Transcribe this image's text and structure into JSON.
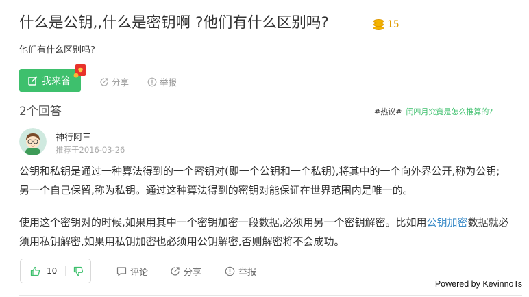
{
  "question": {
    "title": "什么是公钥,,什么是密钥啊 ?他们有什么区别吗?",
    "coin_count": "15",
    "coin_icon": "coin-stack-icon",
    "description": "他们有什么区别吗?",
    "answer_button_label": "我来答",
    "share_label": "分享",
    "report_label": "举报"
  },
  "answers_header": {
    "count_label": "2个回答",
    "hot_tag": "#热议#",
    "hot_link": "闰四月究竟是怎么推算的?"
  },
  "answer": {
    "user_name": "神行阿三",
    "recommend_time": "推荐于2016-03-26",
    "paragraph1": "公钥和私钥是通过一种算法得到的一个密钥对(即一个公钥和一个私钥),将其中的一个向外界公开,称为公钥;另一个自己保留,称为私钥。通过这种算法得到的密钥对能保证在世界范围内是唯一的。",
    "paragraph2_before": "使用这个密钥对的时候,如果用其中一个密钥加密一段数据,必须用另一个密钥解密。比如用",
    "paragraph2_link": "公钥加密",
    "paragraph2_after": "数据就必须用私钥解密,如果用私钥加密也必须用公钥解密,否则解密将不会成功。",
    "like_count": "10",
    "comment_label": "评论",
    "share_label": "分享",
    "report_label": "举报"
  },
  "footer": {
    "powered_by": "Powered by KevinnoTs"
  },
  "colors": {
    "accent_green": "#3ec06d",
    "coin_orange": "#e09a00",
    "link_blue": "#3c8cc8"
  }
}
